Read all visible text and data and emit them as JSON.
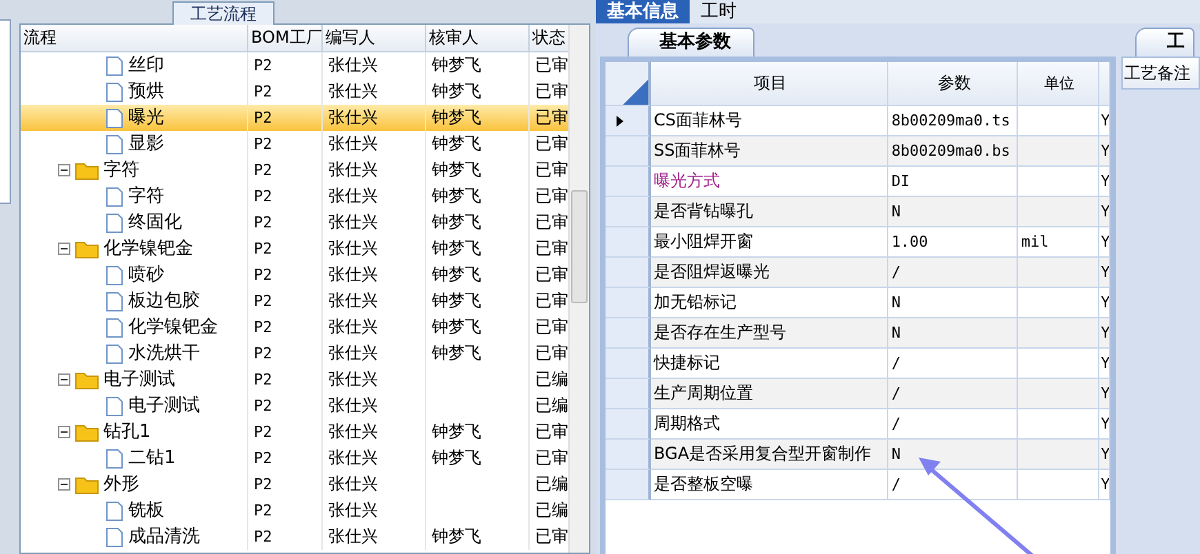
{
  "left_panel": {
    "tab_title": "工艺流程",
    "columns": [
      "流程",
      "BOM工厂",
      "编写人",
      "核审人",
      "状态"
    ],
    "tree": [
      {
        "kind": "leaf",
        "name": "丝印",
        "factory": "P2",
        "writer": "张仕兴",
        "reviewer": "钟梦飞",
        "status": "已审",
        "selected": false
      },
      {
        "kind": "leaf",
        "name": "预烘",
        "factory": "P2",
        "writer": "张仕兴",
        "reviewer": "钟梦飞",
        "status": "已审",
        "selected": false
      },
      {
        "kind": "leaf",
        "name": "曝光",
        "factory": "P2",
        "writer": "张仕兴",
        "reviewer": "钟梦飞",
        "status": "已审",
        "selected": true
      },
      {
        "kind": "leaf",
        "name": "显影",
        "factory": "P2",
        "writer": "张仕兴",
        "reviewer": "钟梦飞",
        "status": "已审",
        "selected": false
      },
      {
        "kind": "folder",
        "name": "字符",
        "factory": "P2",
        "writer": "张仕兴",
        "reviewer": "钟梦飞",
        "status": "已审",
        "selected": false,
        "expanded": true,
        "children": [
          {
            "kind": "leaf",
            "name": "字符",
            "factory": "P2",
            "writer": "张仕兴",
            "reviewer": "钟梦飞",
            "status": "已审",
            "selected": false
          },
          {
            "kind": "leaf",
            "name": "终固化",
            "factory": "P2",
            "writer": "张仕兴",
            "reviewer": "钟梦飞",
            "status": "已审",
            "selected": false
          }
        ]
      },
      {
        "kind": "folder",
        "name": "化学镍钯金",
        "factory": "P2",
        "writer": "张仕兴",
        "reviewer": "钟梦飞",
        "status": "已审",
        "selected": false,
        "expanded": true,
        "children": [
          {
            "kind": "leaf",
            "name": "喷砂",
            "factory": "P2",
            "writer": "张仕兴",
            "reviewer": "钟梦飞",
            "status": "已审",
            "selected": false
          },
          {
            "kind": "leaf",
            "name": "板边包胶",
            "factory": "P2",
            "writer": "张仕兴",
            "reviewer": "钟梦飞",
            "status": "已审",
            "selected": false
          },
          {
            "kind": "leaf",
            "name": "化学镍钯金",
            "factory": "P2",
            "writer": "张仕兴",
            "reviewer": "钟梦飞",
            "status": "已审",
            "selected": false
          },
          {
            "kind": "leaf",
            "name": "水洗烘干",
            "factory": "P2",
            "writer": "张仕兴",
            "reviewer": "钟梦飞",
            "status": "已审",
            "selected": false
          }
        ]
      },
      {
        "kind": "folder",
        "name": "电子测试",
        "factory": "P2",
        "writer": "张仕兴",
        "status": "已编",
        "selected": false,
        "expanded": true,
        "children": [
          {
            "kind": "leaf",
            "name": "电子测试",
            "factory": "P2",
            "writer": "张仕兴",
            "status": "已编",
            "selected": false
          }
        ]
      },
      {
        "kind": "folder",
        "name": "钻孔1",
        "factory": "P2",
        "writer": "张仕兴",
        "reviewer": "钟梦飞",
        "status": "已审",
        "selected": false,
        "expanded": true,
        "children": [
          {
            "kind": "leaf",
            "name": "二钻1",
            "factory": "P2",
            "writer": "张仕兴",
            "reviewer": "钟梦飞",
            "status": "已审",
            "selected": false
          }
        ]
      },
      {
        "kind": "folder",
        "name": "外形",
        "factory": "P2",
        "writer": "张仕兴",
        "status": "已编",
        "selected": false,
        "expanded": true,
        "children": [
          {
            "kind": "leaf",
            "name": "铣板",
            "factory": "P2",
            "writer": "张仕兴",
            "status": "已编",
            "selected": false
          },
          {
            "kind": "leaf",
            "name": "成品清洗",
            "factory": "P2",
            "writer": "张仕兴",
            "reviewer": "钟梦飞",
            "status": "已审",
            "selected": false
          }
        ]
      }
    ]
  },
  "tabs": [
    {
      "label": "基本信息",
      "selected": true
    },
    {
      "label": "工时",
      "selected": false
    }
  ],
  "params_panel": {
    "tab_title": "基本参数",
    "columns": [
      "项目",
      "参数",
      "单位"
    ],
    "rows": [
      {
        "item": "CS面菲林号",
        "value": "8b00209ma0.ts",
        "flag": "Y",
        "selected": true
      },
      {
        "item": "SS面菲林号",
        "value": "8b00209ma0.bs",
        "flag": "Y",
        "selected": false
      },
      {
        "item": "曝光方式",
        "value": "DI",
        "flag": "Y",
        "selected": false,
        "color": "#a0208a"
      },
      {
        "item": "是否背钻曝孔",
        "value": "N",
        "flag": "Y",
        "selected": false
      },
      {
        "item": "最小阻焊开窗",
        "value": "1.00",
        "unit": "mil",
        "flag": "Y",
        "selected": false
      },
      {
        "item": "是否阻焊返曝光",
        "value": "/",
        "flag": "Y",
        "selected": false
      },
      {
        "item": "加无铅标记",
        "value": "N",
        "flag": "Y",
        "selected": false
      },
      {
        "item": "是否存在生产型号",
        "value": "N",
        "flag": "Y",
        "selected": false
      },
      {
        "item": "快捷标记",
        "value": "/",
        "flag": "Y",
        "selected": false
      },
      {
        "item": "生产周期位置",
        "value": "/",
        "flag": "Y",
        "selected": false
      },
      {
        "item": "周期格式",
        "value": "/",
        "flag": "Y",
        "selected": false
      },
      {
        "item": "BGA是否采用复合型开窗制作",
        "value": "N",
        "flag": "Y",
        "selected": false
      },
      {
        "item": "是否整板空曝",
        "value": "/",
        "flag": "Y",
        "selected": false
      }
    ]
  },
  "notes_panel": {
    "tab_title": "工",
    "header": "工艺备注"
  }
}
